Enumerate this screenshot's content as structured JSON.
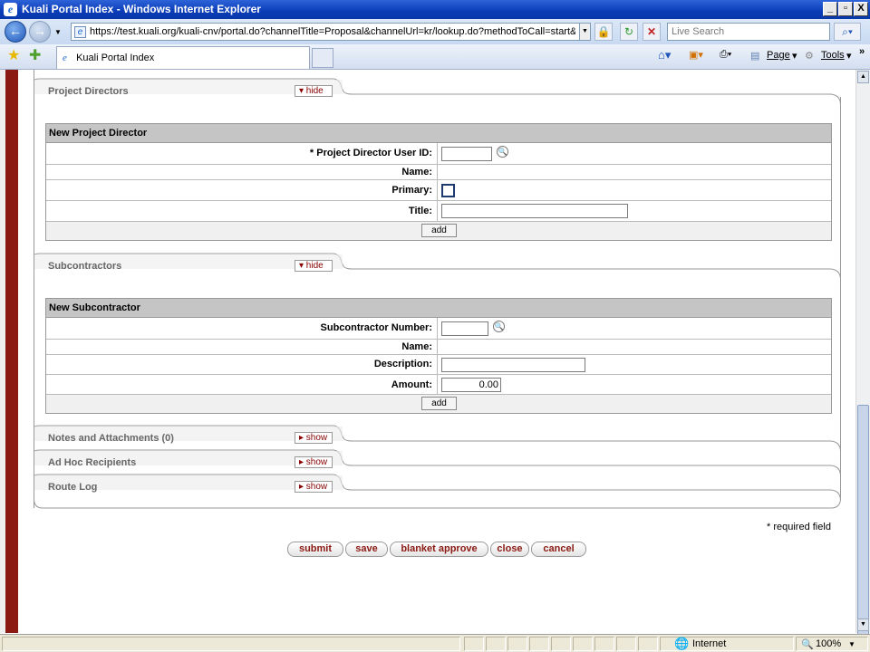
{
  "window": {
    "title": "Kuali Portal Index - Windows Internet Explorer",
    "min": "_",
    "max": "▫",
    "close": "X"
  },
  "nav": {
    "back": "←",
    "forward": "→",
    "url": "https://test.kuali.org/kuali-cnv/portal.do?channelTitle=Proposal&channelUrl=kr/lookup.do?methodToCall=start&business0",
    "search_placeholder": "Live Search"
  },
  "tabbar": {
    "tab_title": "Kuali Portal Index",
    "page_menu": "Page",
    "tools_menu": "Tools"
  },
  "project_directors": {
    "tab_label": "Project Directors",
    "toggle": "▾ hide",
    "section_title": "New Project Director",
    "fields": {
      "user_id_label": "*  Project Director User ID:",
      "name_label": "Name:",
      "primary_label": "Primary:",
      "title_label": "Title:"
    },
    "add_label": "add"
  },
  "subcontractors": {
    "tab_label": "Subcontractors",
    "toggle": "▾ hide",
    "section_title": "New Subcontractor",
    "fields": {
      "number_label": "Subcontractor Number:",
      "name_label": "Name:",
      "description_label": "Description:",
      "amount_label": "Amount:",
      "amount_value": "0.00"
    },
    "add_label": "add"
  },
  "collapsed_tabs": [
    {
      "label": "Notes and Attachments (0)",
      "toggle": "▸ show"
    },
    {
      "label": "Ad Hoc Recipients",
      "toggle": "▸ show"
    },
    {
      "label": "Route Log",
      "toggle": "▸ show"
    }
  ],
  "required_note": "* required field",
  "actions": {
    "submit": "submit",
    "save": "save",
    "blanket_approve": "blanket approve",
    "close": "close",
    "cancel": "cancel"
  },
  "status": {
    "zone": "Internet",
    "zoom": "100%"
  }
}
